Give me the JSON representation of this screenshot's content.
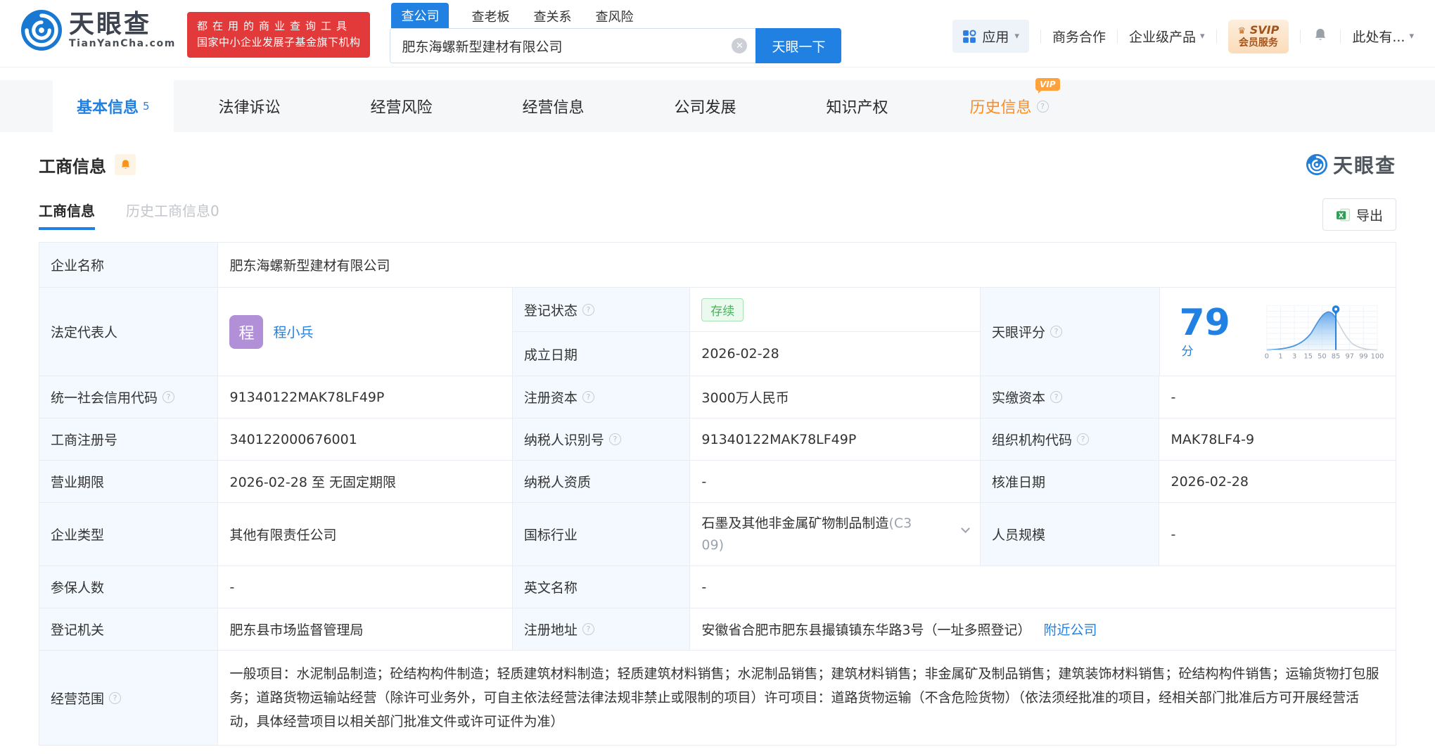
{
  "colors": {
    "accent_blue": "#2181e2",
    "slogan_red": "#e23a3a",
    "vip_orange": "#ff8a1e",
    "status_green": "#4cb05c",
    "avatar_purple": "#b290d8",
    "label_cell_bg": "#f3f9fe"
  },
  "icons": {
    "close": "✕",
    "caret": "▾",
    "help": "?",
    "crown": "♛",
    "excel_x": "X"
  },
  "header": {
    "brand": "天眼查",
    "brand_domain": "TianYanCha.com",
    "slogan_line1": "都在用的商业查询工具",
    "slogan_line2": "国家中小企业发展子基金旗下机构",
    "search_tabs": [
      {
        "label": "查公司"
      },
      {
        "label": "查老板"
      },
      {
        "label": "查关系"
      },
      {
        "label": "查风险"
      }
    ],
    "search_value": "肥东海螺新型建材有限公司",
    "search_button": "天眼一下",
    "apps": "应用",
    "biz_coop": "商务合作",
    "enterprise_products": "企业级产品",
    "svip_top": "SVIP",
    "svip_bottom": "会员服务",
    "user_menu": "此处有..."
  },
  "main_tabs": [
    {
      "label": "基本信息",
      "count": "5"
    },
    {
      "label": "法律诉讼"
    },
    {
      "label": "经营风险"
    },
    {
      "label": "经营信息"
    },
    {
      "label": "公司发展"
    },
    {
      "label": "知识产权"
    },
    {
      "label": "历史信息",
      "vip": "VIP"
    }
  ],
  "section": {
    "title": "工商信息",
    "watermark": "天眼查",
    "subtab_active": "工商信息",
    "subtab_history": "历史工商信息",
    "subtab_history_count": "0",
    "export_label": "导出"
  },
  "table": {
    "company_name": {
      "label": "企业名称",
      "value": "肥东海螺新型建材有限公司"
    },
    "legal_rep": {
      "label": "法定代表人",
      "avatar_char": "程",
      "name": "程小兵"
    },
    "reg_status": {
      "label": "登记状态",
      "value": "存续"
    },
    "est_date": {
      "label": "成立日期",
      "value": "2026-02-28"
    },
    "score": {
      "label": "天眼评分",
      "value": "79",
      "unit": "分",
      "marker_tick": "85",
      "axis": [
        "0",
        "1",
        "3",
        "15",
        "50",
        "85",
        "97",
        "99",
        "100"
      ]
    },
    "credit_code": {
      "label": "统一社会信用代码",
      "value": "91340122MAK78LF49P"
    },
    "reg_capital": {
      "label": "注册资本",
      "value": "3000万人民币"
    },
    "paid_capital": {
      "label": "实缴资本",
      "value": "-"
    },
    "reg_number": {
      "label": "工商注册号",
      "value": "340122000676001"
    },
    "taxpayer_id": {
      "label": "纳税人识别号",
      "value": "91340122MAK78LF49P"
    },
    "org_code": {
      "label": "组织机构代码",
      "value": "MAK78LF4-9"
    },
    "business_term": {
      "label": "营业期限",
      "value": "2026-02-28 至 无固定期限"
    },
    "taxpayer_qual": {
      "label": "纳税人资质",
      "value": "-"
    },
    "approval_date": {
      "label": "核准日期",
      "value": "2026-02-28"
    },
    "company_type": {
      "label": "企业类型",
      "value": "其他有限责任公司"
    },
    "industry": {
      "label": "国标行业",
      "value": "石墨及其他非金属矿物制品制造",
      "code": "(C309)"
    },
    "staff_size": {
      "label": "人员规模",
      "value": "-"
    },
    "insured_count": {
      "label": "参保人数",
      "value": "-"
    },
    "english_name": {
      "label": "英文名称",
      "value": "-"
    },
    "reg_authority": {
      "label": "登记机关",
      "value": "肥东县市场监督管理局"
    },
    "reg_address": {
      "label": "注册地址",
      "value": "安徽省合肥市肥东县撮镇镇东华路3号（一址多照登记）",
      "link": "附近公司"
    },
    "business_scope": {
      "label": "经营范围",
      "value": "一般项目：水泥制品制造；砼结构构件制造；轻质建筑材料制造；轻质建筑材料销售；水泥制品销售；建筑材料销售；非金属矿及制品销售；建筑装饰材料销售；砼结构构件销售；运输货物打包服务；道路货物运输站经营（除许可业务外，可自主依法经营法律法规非禁止或限制的项目）许可项目：道路货物运输（不含危险货物）（依法须经批准的项目，经相关部门批准后方可开展经营活动，具体经营项目以相关部门批准文件或许可证件为准）"
    }
  }
}
